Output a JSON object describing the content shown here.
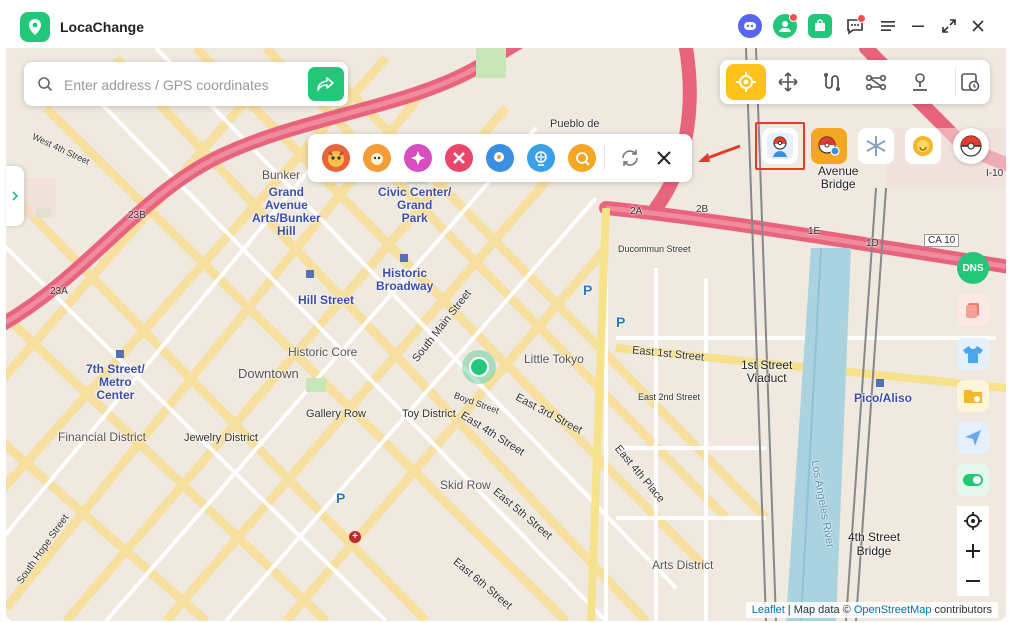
{
  "app": {
    "title": "LocaChange"
  },
  "search": {
    "placeholder": "Enter address / GPS coordinates"
  },
  "map_labels": {
    "downtown": "Downtown",
    "financial_district": "Financial District",
    "historic_core": "Historic Core",
    "gallery_row": "Gallery Row",
    "jewelry_district": "Jewelry District",
    "toy_district": "Toy District",
    "little_tokyo": "Little Tokyo",
    "skid_row": "Skid Row",
    "arts_district": "Arts District",
    "pueblo": "Pueblo de",
    "bunker_hill_small": "Bunker",
    "grand_ave": "Grand\nAvenue\nArts/Bunker\nHill",
    "civic_center": "Civic Center/\nGrand\nPark",
    "historic_broadway": "Historic\nBroadway",
    "hill_street": "Hill Street",
    "seventh_metro": "7th Street/\nMetro\nCenter",
    "first_viaduct": "1st Street\nViaduct",
    "pico_aliso": "Pico/Aliso",
    "fourth_bridge": "4th Street\nBridge",
    "avenue_bridge": "Avenue\nBridge",
    "east_1st": "East 1st Street",
    "east_2nd": "East 2nd Street",
    "east_3rd": "East 3rd Street",
    "east_4th": "East 4th Street",
    "east_5th": "East 5th Street",
    "east_6th": "East 6th Street",
    "east_4th_place": "East 4th Place",
    "ducommun": "Ducommun Street",
    "main_street": "South Main Street",
    "boyd": "Boyd Street",
    "la_river": "Los Angeles River",
    "ca10": "CA 10",
    "w4th": "West 4th Street",
    "s_hope": "South Hope Street",
    "ramp_2a": "2A",
    "ramp_2b": "2B",
    "ramp_1e": "1E",
    "ramp_1d": "1D",
    "ramp_23a": "23A",
    "ramp_23b": "23B",
    "i10": "I-10"
  },
  "attribution": {
    "leaflet": "Leaflet",
    "sep": " | Map data © ",
    "osm": "OpenStreetMap",
    "contrib": " contributors"
  },
  "icons": {
    "titlebar": [
      "discord-icon",
      "account-icon",
      "shop-icon",
      "feedback-icon",
      "menu-icon",
      "minimize-icon",
      "fullscreen-icon",
      "close-icon"
    ],
    "modes": [
      "teleport-icon",
      "joystick-icon",
      "two-spot-icon",
      "multi-spot-icon",
      "jump-icon",
      "history-icon"
    ]
  },
  "colors": {
    "accent": "#24c77a",
    "active_mode": "#ffc21a",
    "highlight": "#e53b2c"
  }
}
